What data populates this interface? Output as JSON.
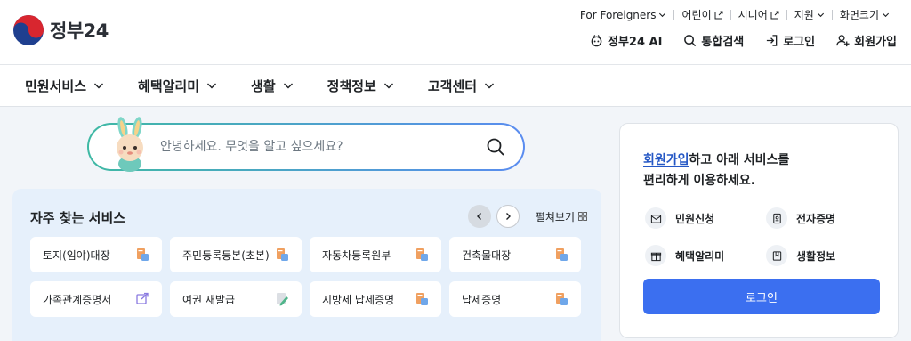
{
  "logo": {
    "text": "정부",
    "num": "24"
  },
  "utility": {
    "foreigners": "For Foreigners",
    "kids": "어린이",
    "senior": "시니어",
    "support": "지원",
    "screen_size": "화면크기"
  },
  "main_menu": {
    "ai": "정부24 AI",
    "search": "통합검색",
    "login": "로그인",
    "signup": "회원가입"
  },
  "nav": [
    {
      "label": "민원서비스"
    },
    {
      "label": "혜택알리미"
    },
    {
      "label": "생활"
    },
    {
      "label": "정책정보"
    },
    {
      "label": "고객센터"
    }
  ],
  "search": {
    "placeholder": "안녕하세요. 무엇을 알고 싶으세요?"
  },
  "frequent": {
    "title": "자주 찾는 서비스",
    "expand": "펼쳐보기",
    "items": [
      {
        "label": "토지(임야)대장",
        "icon": "document-stamp-icon"
      },
      {
        "label": "주민등록등본(초본)",
        "icon": "document-stamp-icon"
      },
      {
        "label": "자동차등록원부",
        "icon": "document-stamp-icon"
      },
      {
        "label": "건축물대장",
        "icon": "document-stamp-icon"
      },
      {
        "label": "가족관계증명서",
        "icon": "external-link-icon"
      },
      {
        "label": "여권 재발급",
        "icon": "document-pen-icon"
      },
      {
        "label": "지방세 납세증명",
        "icon": "document-stamp-icon"
      },
      {
        "label": "납세증명",
        "icon": "document-stamp-icon"
      }
    ]
  },
  "login_panel": {
    "signup_link": "회원가입",
    "message_rest": "하고 아래 서비스를",
    "message_line2": "편리하게 이용하세요.",
    "links": [
      {
        "label": "민원신청"
      },
      {
        "label": "전자증명"
      },
      {
        "label": "혜택알리미"
      },
      {
        "label": "생활정보"
      }
    ],
    "login_button": "로그인"
  },
  "colors": {
    "accent": "#3b6ff0",
    "link": "#2457c5",
    "panel_bg": "#e6f0fb"
  }
}
